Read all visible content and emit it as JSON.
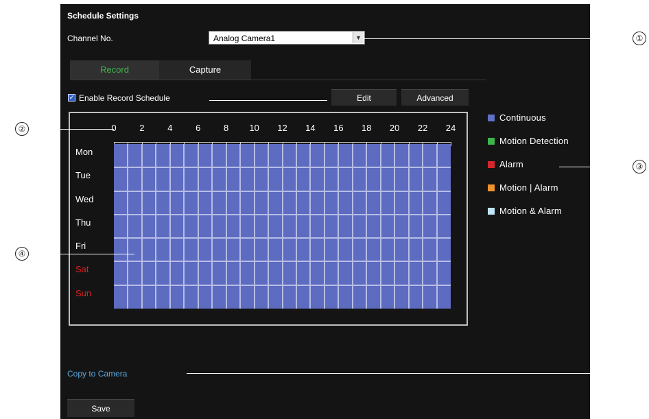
{
  "panel": {
    "title": "Schedule Settings",
    "channel_label": "Channel No.",
    "channel_value": "Analog Camera1"
  },
  "tabs": [
    {
      "label": "Record",
      "active": true
    },
    {
      "label": "Capture",
      "active": false
    }
  ],
  "enable_schedule": {
    "label": "Enable Record Schedule",
    "checked": true
  },
  "buttons": {
    "edit": "Edit",
    "advanced": "Advanced",
    "save": "Save"
  },
  "hours": [
    "0",
    "2",
    "4",
    "6",
    "8",
    "10",
    "12",
    "14",
    "16",
    "18",
    "20",
    "22",
    "24"
  ],
  "days": [
    {
      "label": "Mon",
      "weekend": false
    },
    {
      "label": "Tue",
      "weekend": false
    },
    {
      "label": "Wed",
      "weekend": false
    },
    {
      "label": "Thu",
      "weekend": false
    },
    {
      "label": "Fri",
      "weekend": false
    },
    {
      "label": "Sat",
      "weekend": true
    },
    {
      "label": "Sun",
      "weekend": true
    }
  ],
  "schedule_mode": "Continuous",
  "legend": [
    {
      "label": "Continuous",
      "color": "#6170c4"
    },
    {
      "label": "Motion Detection",
      "color": "#3cb54a"
    },
    {
      "label": "Alarm",
      "color": "#d6262d"
    },
    {
      "label": "Motion | Alarm",
      "color": "#f0932e"
    },
    {
      "label": "Motion & Alarm",
      "color": "#bfe6f6"
    }
  ],
  "copy_link": "Copy to Camera",
  "callouts": [
    "①",
    "②",
    "③",
    "④"
  ]
}
